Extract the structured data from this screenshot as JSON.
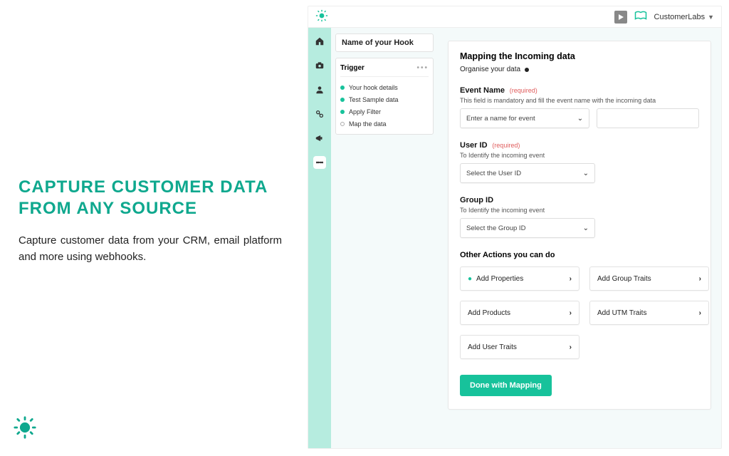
{
  "marketing": {
    "headline": "CAPTURE CUSTOMER DATA FROM ANY SOURCE",
    "body": "Capture customer data from your CRM, email platform and more using webhooks."
  },
  "topbar": {
    "account_label": "CustomerLabs"
  },
  "steps": {
    "hook_name_title": "Name of your Hook",
    "trigger_title": "Trigger",
    "items": [
      {
        "label": "Your hook details",
        "done": true
      },
      {
        "label": "Test Sample data",
        "done": true
      },
      {
        "label": "Apply Filter",
        "done": true
      },
      {
        "label": "Map the data",
        "done": false
      }
    ]
  },
  "panel": {
    "title": "Mapping the Incoming data",
    "subtitle": "Organise your data",
    "event": {
      "label": "Event Name",
      "required_text": "(required)",
      "desc": "This field is mandatory and fill the event name with the incoming data",
      "placeholder": "Enter a name for event"
    },
    "user": {
      "label": "User ID",
      "required_text": "(required)",
      "desc": "To Identify the incoming event",
      "placeholder": "Select the User ID"
    },
    "group": {
      "label": "Group ID",
      "desc": "To Identify the incoming event",
      "placeholder": "Select the Group ID"
    },
    "other_title": "Other Actions you can do",
    "actions": [
      {
        "label": "Add Properties",
        "marked": true
      },
      {
        "label": "Add Group Traits",
        "marked": false
      },
      {
        "label": "Add Products",
        "marked": false
      },
      {
        "label": "Add UTM Traits",
        "marked": false
      },
      {
        "label": "Add User Traits",
        "marked": false
      }
    ],
    "done_button": "Done with Mapping"
  }
}
